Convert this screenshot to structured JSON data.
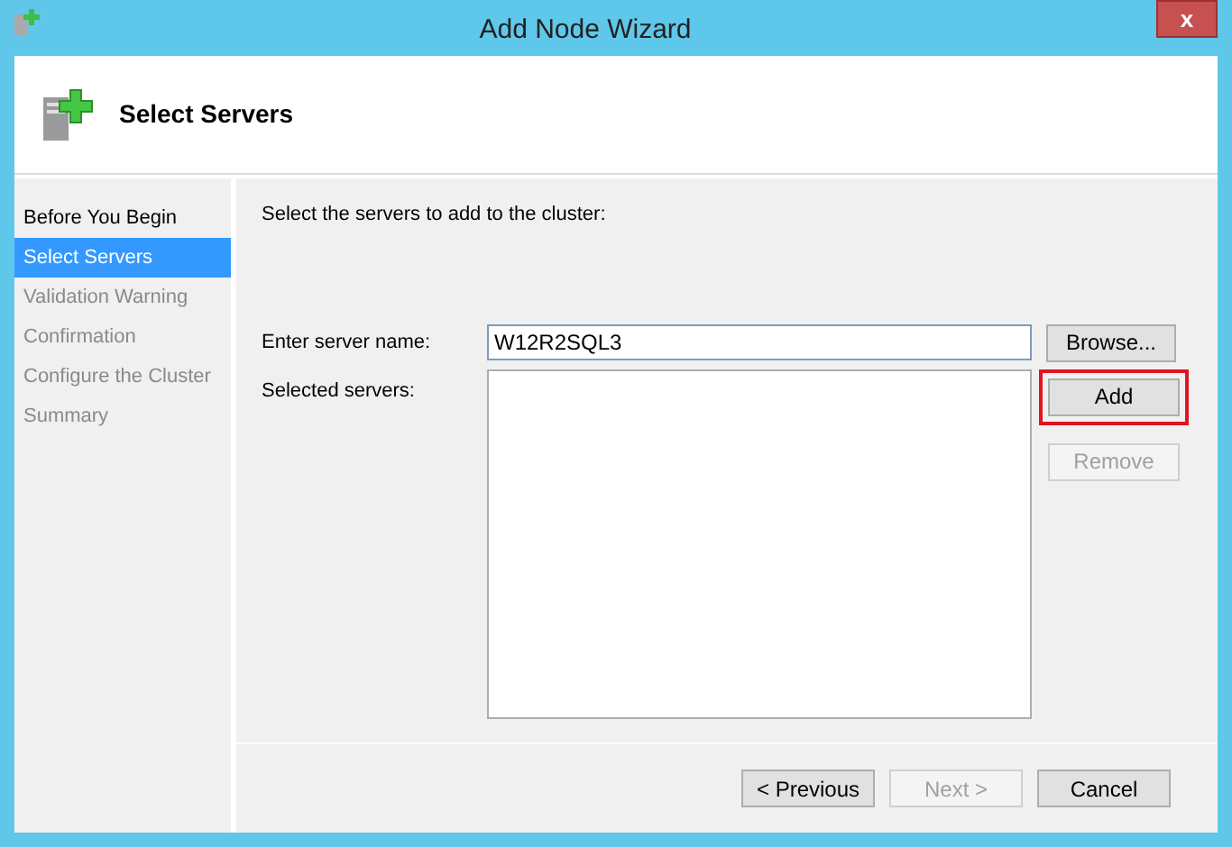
{
  "window": {
    "title": "Add Node Wizard",
    "close": "x"
  },
  "header": {
    "title": "Select Servers"
  },
  "steps": [
    {
      "label": "Before You Begin",
      "selected": false,
      "disabled": false
    },
    {
      "label": "Select Servers",
      "selected": true,
      "disabled": false
    },
    {
      "label": "Validation Warning",
      "selected": false,
      "disabled": true
    },
    {
      "label": "Confirmation",
      "selected": false,
      "disabled": true
    },
    {
      "label": "Configure the Cluster",
      "selected": false,
      "disabled": true
    },
    {
      "label": "Summary",
      "selected": false,
      "disabled": true
    }
  ],
  "instruction": "Select the servers to add to the cluster:",
  "server_name": {
    "label": "Enter server name:",
    "value": "W12R2SQL3"
  },
  "selected_servers": {
    "label": "Selected servers:"
  },
  "side_buttons": [
    {
      "label": "Browse...",
      "disabled": false
    },
    {
      "label": "Add",
      "disabled": false,
      "highlighted": true
    },
    {
      "label": "Remove",
      "disabled": true
    }
  ],
  "footer_buttons": [
    {
      "label": "< Previous",
      "disabled": false
    },
    {
      "label": "Next >",
      "disabled": true
    },
    {
      "label": "Cancel",
      "disabled": false
    }
  ]
}
